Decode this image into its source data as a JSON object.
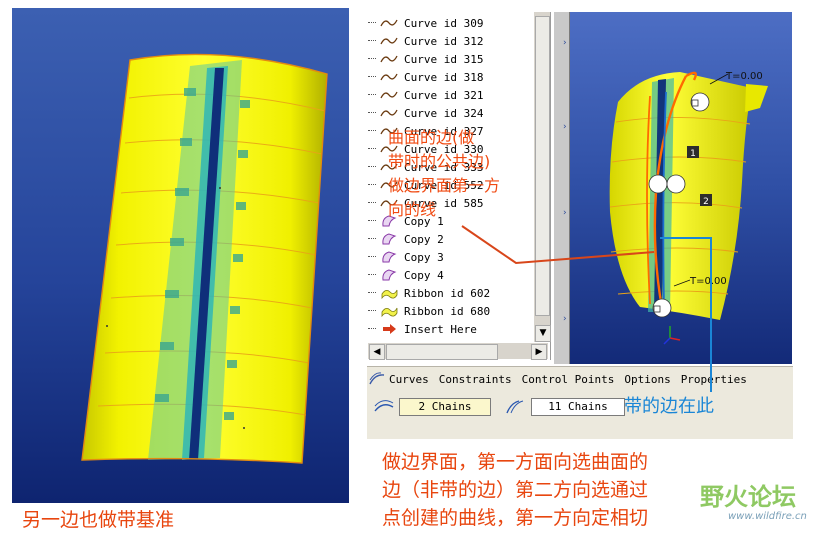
{
  "left_view": {
    "caption": "另一边也做带基准"
  },
  "model_tree": {
    "items": [
      {
        "icon": "curve-icon",
        "label": "Curve id 309"
      },
      {
        "icon": "curve-icon",
        "label": "Curve id 312"
      },
      {
        "icon": "curve-icon",
        "label": "Curve id 315"
      },
      {
        "icon": "curve-icon",
        "label": "Curve id 318"
      },
      {
        "icon": "curve-icon",
        "label": "Curve id 321"
      },
      {
        "icon": "curve-icon",
        "label": "Curve id 324"
      },
      {
        "icon": "curve-icon",
        "label": "Curve id 327"
      },
      {
        "icon": "curve-icon",
        "label": "Curve id 330"
      },
      {
        "icon": "curve-icon",
        "label": "Curve id 333"
      },
      {
        "icon": "curve-icon",
        "label": "Curve id 552"
      },
      {
        "icon": "curve-icon",
        "label": "Curve id 585"
      },
      {
        "icon": "copy-icon",
        "label": "Copy 1"
      },
      {
        "icon": "copy-icon",
        "label": "Copy 2"
      },
      {
        "icon": "copy-icon",
        "label": "Copy 3"
      },
      {
        "icon": "copy-icon",
        "label": "Copy 4"
      },
      {
        "icon": "ribbon-icon",
        "label": "Ribbon id 602"
      },
      {
        "icon": "ribbon-icon",
        "label": "Ribbon id 680"
      },
      {
        "icon": "insert-arrow-icon",
        "label": "Insert Here"
      }
    ]
  },
  "viewport": {
    "top_t_label": "T=0.00",
    "bottom_t_label": "T=0.00",
    "chain_marker_1": "1",
    "chain_marker_2": "2"
  },
  "dashboard": {
    "tabs": [
      "Curves",
      "Constraints",
      "Control Points",
      "Options",
      "Properties"
    ],
    "first_direction_chains": "2 Chains",
    "second_direction_chains": "11 Chains"
  },
  "annotations": {
    "surface_note_lines": [
      "曲面的边(做",
      "带时的公共边)",
      "做边界面第一方",
      "向的线"
    ],
    "edge_note": "带的边在此",
    "bottom_note_lines": [
      "做边界面，第一方面向选曲面的",
      "边（非带的边）第二方向选通过",
      "点创建的曲线，第一方向定相切"
    ]
  },
  "watermark": {
    "text": "野火论坛",
    "url": "www.wildfire.cn"
  },
  "colors": {
    "surface_yellow": "#f2f200",
    "viewport_blue": "#2f4fa5",
    "ribbon_cyan": "#23b0a0",
    "annotation_orange": "#e8460f",
    "annotation_blue": "#1a86d6",
    "field_yellow": "#fbf7cc"
  }
}
